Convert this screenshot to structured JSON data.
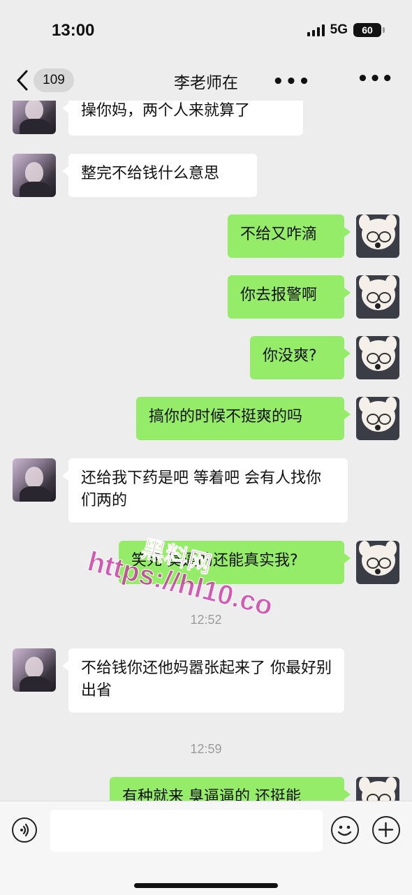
{
  "status_bar": {
    "time": "13:00",
    "network": "5G",
    "battery": "60"
  },
  "header": {
    "back_count": "109",
    "title": "李老师在",
    "title_suffix": "•••",
    "more": "•••"
  },
  "messages": [
    {
      "side": "in",
      "text": "操你妈，两个人来就算了"
    },
    {
      "side": "in",
      "text": "整完不给钱什么意思"
    },
    {
      "side": "out",
      "text": "不给又咋滴"
    },
    {
      "side": "out",
      "text": "你去报警啊"
    },
    {
      "side": "out",
      "text": "你没爽?"
    },
    {
      "side": "out",
      "text": "搞你的时候不挺爽的吗"
    },
    {
      "side": "in",
      "text": "还给我下药是吧  等着吧  会有人找你们两的"
    },
    {
      "side": "out",
      "text": "笑死 臭逼的还能真实我?"
    },
    {
      "side": "in",
      "text": "不给钱你还他妈嚣张起来了   你最好别出省"
    },
    {
      "side": "out",
      "text": "有种就来 臭逼逼的 还挺能"
    }
  ],
  "timestamps": [
    "12:52",
    "12:59"
  ],
  "watermark": {
    "line1": "黑料网",
    "line2": "https://hl10.co"
  },
  "icons": {
    "voice": "voice-icon",
    "emoji": "emoji-icon",
    "add": "plus-icon",
    "back": "chevron-left-icon"
  }
}
